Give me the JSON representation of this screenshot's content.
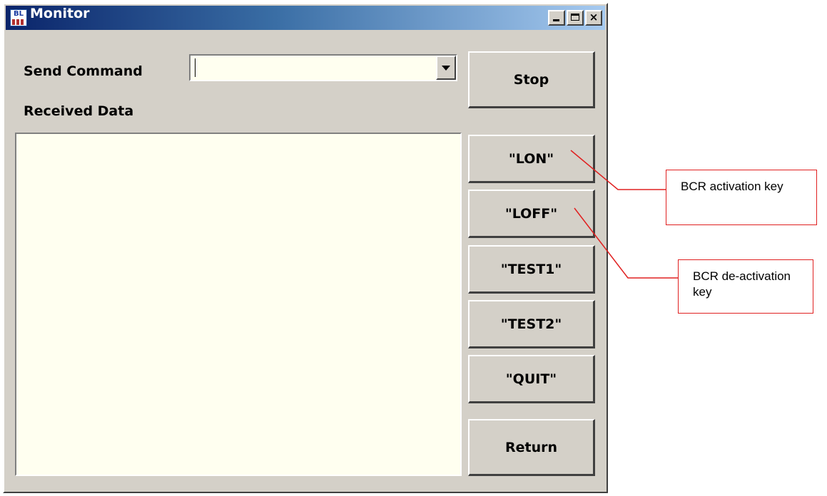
{
  "window": {
    "title": "Monitor",
    "icon": "bl-app-icon",
    "controls": {
      "minimize": "minimize-icon",
      "maximize": "maximize-icon",
      "close_label": "×"
    }
  },
  "send_command": {
    "label": "Send Command",
    "value": ""
  },
  "received_data": {
    "label": "Received Data",
    "content": ""
  },
  "buttons": {
    "stop": "Stop",
    "lon": "\"LON\"",
    "loff": "\"LOFF\"",
    "test1": "\"TEST1\"",
    "test2": "\"TEST2\"",
    "quit": "\"QUIT\"",
    "return": "Return"
  },
  "callouts": {
    "activation": "BCR activation key",
    "deactivation": "BCR de-activation key",
    "line_color": "#e02020"
  },
  "colors": {
    "title_bar_start": "#0a246a",
    "title_bar_end": "#a6caf0",
    "field_background": "#fffff0",
    "window_face": "#d4d0c8"
  }
}
